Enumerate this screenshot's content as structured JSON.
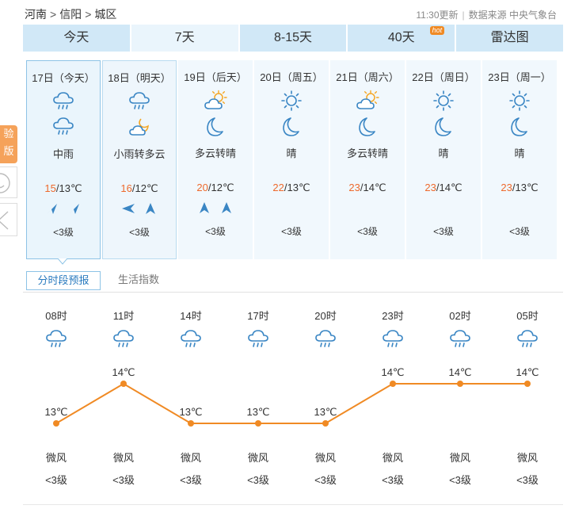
{
  "breadcrumb": {
    "province": "河南",
    "city": "信阳",
    "district": "城区",
    "sep": ">"
  },
  "meta": {
    "update": "11:30更新",
    "source": "数据来源 中央气象台",
    "divider": "|"
  },
  "tabs": [
    {
      "label": "今天"
    },
    {
      "label": "7天"
    },
    {
      "label": "8-15天"
    },
    {
      "label": "40天",
      "badge": "hot"
    },
    {
      "label": "雷达图"
    }
  ],
  "side": {
    "tag_line1": "验",
    "tag_line2": "版"
  },
  "colors": {
    "accent": "#2a7bbf",
    "high_temp": "#ee6a2d",
    "line": "#f08a24",
    "tab_bg": "#d1e8f7"
  },
  "days": [
    {
      "date": "17日（今天）",
      "icons": [
        "rain-cloud-icon",
        "rain-cloud-icon"
      ],
      "desc": "中雨",
      "high": "15",
      "low": "/13℃",
      "winds": [
        "arrow-northeast-icon",
        "arrow-northeast-icon"
      ],
      "level": "<3级"
    },
    {
      "date": "18日（明天）",
      "icons": [
        "rain-cloud-icon",
        "cloudy-night-icon"
      ],
      "desc": "小雨转多云",
      "high": "16",
      "low": "/12℃",
      "winds": [
        "arrow-west-icon",
        "arrow-north-icon"
      ],
      "level": "<3级"
    },
    {
      "date": "19日（后天）",
      "icons": [
        "partly-cloudy-icon",
        "moon-icon"
      ],
      "desc": "多云转晴",
      "high": "20",
      "low": "/12℃",
      "winds": [
        "arrow-north-icon",
        "arrow-north-icon"
      ],
      "level": "<3级"
    },
    {
      "date": "20日（周五）",
      "icons": [
        "sun-icon",
        "moon-icon"
      ],
      "desc": "晴",
      "high": "22",
      "low": "/13℃",
      "winds": [],
      "level": "<3级"
    },
    {
      "date": "21日（周六）",
      "icons": [
        "partly-cloudy-icon",
        "moon-icon"
      ],
      "desc": "多云转晴",
      "high": "23",
      "low": "/14℃",
      "winds": [],
      "level": "<3级"
    },
    {
      "date": "22日（周日）",
      "icons": [
        "sun-icon",
        "moon-icon"
      ],
      "desc": "晴",
      "high": "23",
      "low": "/14℃",
      "winds": [],
      "level": "<3级"
    },
    {
      "date": "23日（周一）",
      "icons": [
        "sun-icon",
        "moon-icon"
      ],
      "desc": "晴",
      "high": "23",
      "low": "/13℃",
      "winds": [],
      "level": "<3级"
    }
  ],
  "subtabs": {
    "hourly": "分时段预报",
    "life": "生活指数"
  },
  "hourly": [
    {
      "time": "08时",
      "icon": "rain-cloud-icon",
      "temp": 13,
      "temp_label": "13℃",
      "wind": "微风",
      "level": "<3级"
    },
    {
      "time": "11时",
      "icon": "rain-cloud-icon",
      "temp": 14,
      "temp_label": "14℃",
      "wind": "微风",
      "level": "<3级"
    },
    {
      "time": "14时",
      "icon": "rain-cloud-icon",
      "temp": 13,
      "temp_label": "13℃",
      "wind": "微风",
      "level": "<3级"
    },
    {
      "time": "17时",
      "icon": "rain-cloud-icon",
      "temp": 13,
      "temp_label": "13℃",
      "wind": "微风",
      "level": "<3级"
    },
    {
      "time": "20时",
      "icon": "rain-cloud-icon",
      "temp": 13,
      "temp_label": "13℃",
      "wind": "微风",
      "level": "<3级"
    },
    {
      "time": "23时",
      "icon": "rain-cloud-icon",
      "temp": 14,
      "temp_label": "14℃",
      "wind": "微风",
      "level": "<3级"
    },
    {
      "time": "02时",
      "icon": "rain-cloud-icon",
      "temp": 14,
      "temp_label": "14℃",
      "wind": "微风",
      "level": "<3级"
    },
    {
      "time": "05时",
      "icon": "rain-cloud-icon",
      "temp": 14,
      "temp_label": "14℃",
      "wind": "微风",
      "level": "<3级"
    }
  ]
}
